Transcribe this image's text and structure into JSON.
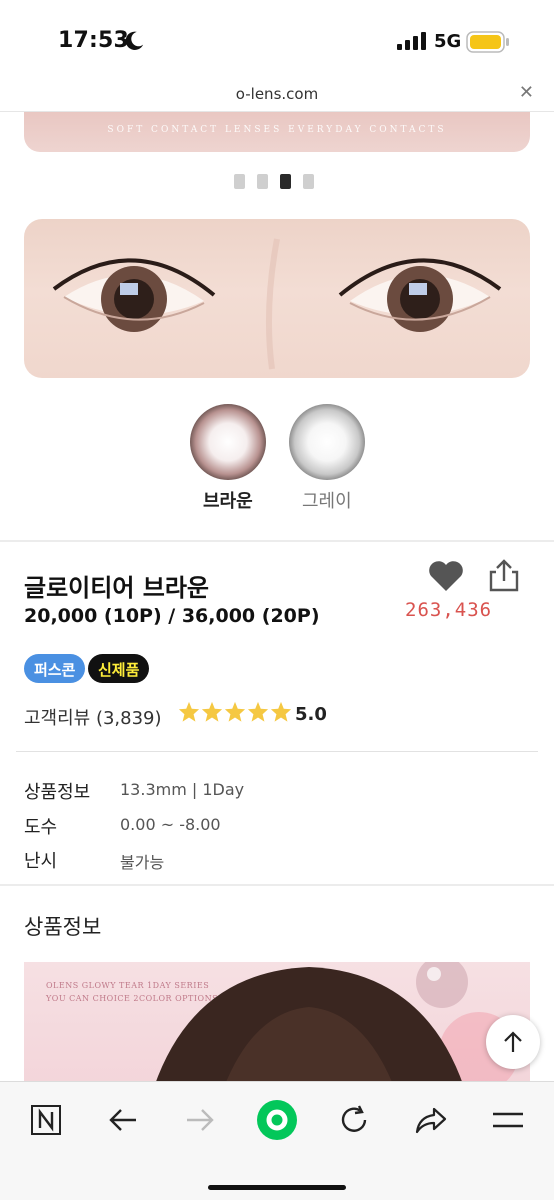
{
  "status_bar": {
    "time": "17:53",
    "network": "5G",
    "battery_color": "#f5c518"
  },
  "browser": {
    "url": "o-lens.com",
    "close_label": "✕"
  },
  "banner": {
    "text": "SOFT CONTACT LENSES EVERYDAY CONTACTS"
  },
  "carousel": {
    "total_dots": 4,
    "active_index": 2
  },
  "colors": [
    {
      "label": "브라운",
      "selected": true
    },
    {
      "label": "그레이",
      "selected": false
    }
  ],
  "product": {
    "title": "글로이티어 브라운",
    "price": "20,000 (10P) / 36,000 (20P)",
    "like_count": "263,436",
    "badges": [
      "퍼스콘",
      "신제품"
    ],
    "review_label": "고객리뷰 (3,839)",
    "rating": "5.0",
    "star_color": "#f5c842"
  },
  "specs": [
    {
      "label": "상품정보",
      "value": "13.3mm | 1Day"
    },
    {
      "label": "도수",
      "value": "0.00 ~ -8.00"
    },
    {
      "label": "난시",
      "value": "불가능"
    }
  ],
  "detail": {
    "section_title": "상품정보",
    "caption_line1": "OLENS GLOWY TEAR 1DAY SERIES",
    "caption_line2": "YOU CAN CHOICE 2COLOR OPTIONS"
  },
  "toolbar": {
    "items": [
      "naver-icon",
      "back-arrow-icon",
      "forward-arrow-icon",
      "home-green-icon",
      "refresh-icon",
      "share-forward-icon",
      "menu-icon"
    ],
    "accent": "#03c75a"
  }
}
